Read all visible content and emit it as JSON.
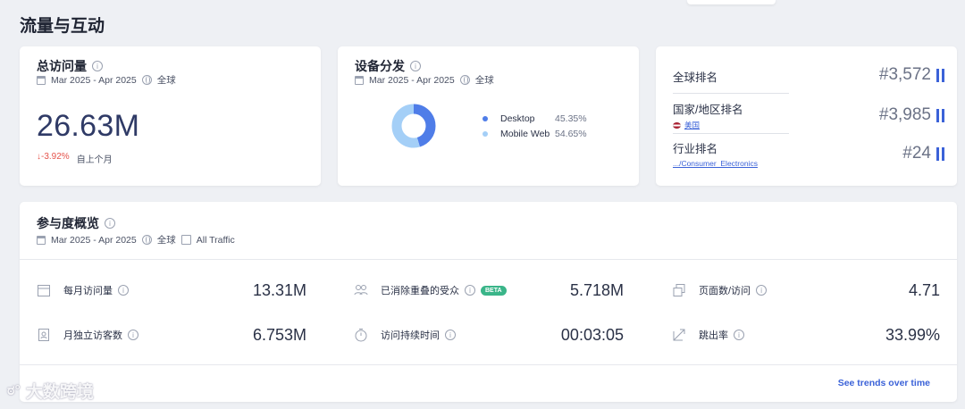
{
  "page": {
    "title": "流量与互动"
  },
  "visits": {
    "title": "总访问量",
    "date_range": "Mar 2025 - Apr 2025",
    "region": "全球",
    "value": "26.63M",
    "change": "-3.92%",
    "change_period": "自上个月"
  },
  "device": {
    "title": "设备分发",
    "date_range": "Mar 2025 - Apr 2025",
    "region": "全球",
    "items": [
      {
        "name": "Desktop",
        "value": "45.35%",
        "share": 45.35,
        "color": "#4f7de8"
      },
      {
        "name": "Mobile Web",
        "value": "54.65%",
        "share": 54.65,
        "color": "#a4cff7"
      }
    ]
  },
  "ranking": {
    "global": {
      "label": "全球排名",
      "value": "#3,572"
    },
    "country": {
      "label": "国家/地区排名",
      "sub": "美国",
      "value": "#3,985"
    },
    "industry": {
      "label": "行业排名",
      "sub": ".../Consumer_Electronics",
      "value": "#24"
    }
  },
  "engagement": {
    "title": "参与度概览",
    "date_range": "Mar 2025 - Apr 2025",
    "region": "全球",
    "traffic": "All Traffic",
    "metrics": [
      {
        "label": "每月访问量",
        "value": "13.31M",
        "icon": "calendar-icon"
      },
      {
        "label": "已消除重叠的受众",
        "value": "5.718M",
        "icon": "users-icon",
        "badge": "BETA"
      },
      {
        "label": "页面数/访问",
        "value": "4.71",
        "icon": "pages-icon"
      },
      {
        "label": "月独立访客数",
        "value": "6.753M",
        "icon": "visitor-card-icon"
      },
      {
        "label": "访问持续时间",
        "value": "00:03:05",
        "icon": "stopwatch-icon"
      },
      {
        "label": "跳出率",
        "value": "33.99%",
        "icon": "trend-icon"
      }
    ],
    "see_trends": "See trends over time"
  },
  "watermark": "大数跨境",
  "colors": {
    "accent": "#3b62d8",
    "negative": "#e5534b",
    "beta": "#3ab589"
  }
}
